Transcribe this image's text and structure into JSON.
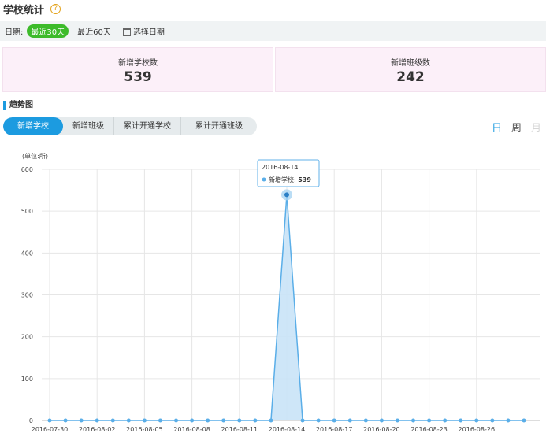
{
  "header": {
    "title": "学校统计",
    "help_icon": "question-circle-icon"
  },
  "date_bar": {
    "label": "日期:",
    "ranges": [
      {
        "label": "最近30天",
        "active": true
      },
      {
        "label": "最近60天",
        "active": false
      }
    ],
    "picker_icon": "calendar-icon",
    "picker_label": "选择日期"
  },
  "stats": [
    {
      "label": "新增学校数",
      "value": "539"
    },
    {
      "label": "新增班级数",
      "value": "242"
    }
  ],
  "trend": {
    "heading": "趋势图",
    "tabs": [
      {
        "label": "新增学校",
        "active": true
      },
      {
        "label": "新增班级",
        "active": false
      },
      {
        "label": "累计开通学校",
        "active": false
      },
      {
        "label": "累计开通班级",
        "active": false
      }
    ],
    "periods": [
      {
        "label": "日",
        "state": "active"
      },
      {
        "label": "周",
        "state": "normal"
      },
      {
        "label": "月",
        "state": "disabled"
      }
    ]
  },
  "colors": {
    "accent": "#1c9be0",
    "active_range": "#3dbb2b",
    "series_fill": "#c9e3f7",
    "series_line": "#5aaee8"
  },
  "chart_data": {
    "type": "area",
    "unit_label": "(单位:所)",
    "ylim": [
      0,
      600
    ],
    "y_ticks": [
      0,
      100,
      200,
      300,
      400,
      500,
      600
    ],
    "x": [
      "2016-07-30",
      "2016-07-31",
      "2016-08-01",
      "2016-08-02",
      "2016-08-03",
      "2016-08-04",
      "2016-08-05",
      "2016-08-06",
      "2016-08-07",
      "2016-08-08",
      "2016-08-09",
      "2016-08-10",
      "2016-08-11",
      "2016-08-12",
      "2016-08-13",
      "2016-08-14",
      "2016-08-15",
      "2016-08-16",
      "2016-08-17",
      "2016-08-18",
      "2016-08-19",
      "2016-08-20",
      "2016-08-21",
      "2016-08-22",
      "2016-08-23",
      "2016-08-24",
      "2016-08-25",
      "2016-08-26",
      "2016-08-27",
      "2016-08-28",
      "2016-08-29"
    ],
    "x_tick_labels": [
      "2016-07-30",
      "2016-08-02",
      "2016-08-05",
      "2016-08-08",
      "2016-08-11",
      "2016-08-14",
      "2016-08-17",
      "2016-08-20",
      "2016-08-23",
      "2016-08-26"
    ],
    "series": [
      {
        "name": "新增学校",
        "values": [
          0,
          0,
          0,
          0,
          0,
          0,
          0,
          0,
          0,
          0,
          0,
          0,
          0,
          0,
          0,
          539,
          0,
          0,
          0,
          0,
          0,
          0,
          0,
          0,
          0,
          0,
          0,
          0,
          0,
          0,
          0
        ]
      }
    ],
    "grid": true,
    "tooltip": {
      "date": "2016-08-14",
      "series": "新增学校",
      "value": "539"
    }
  }
}
